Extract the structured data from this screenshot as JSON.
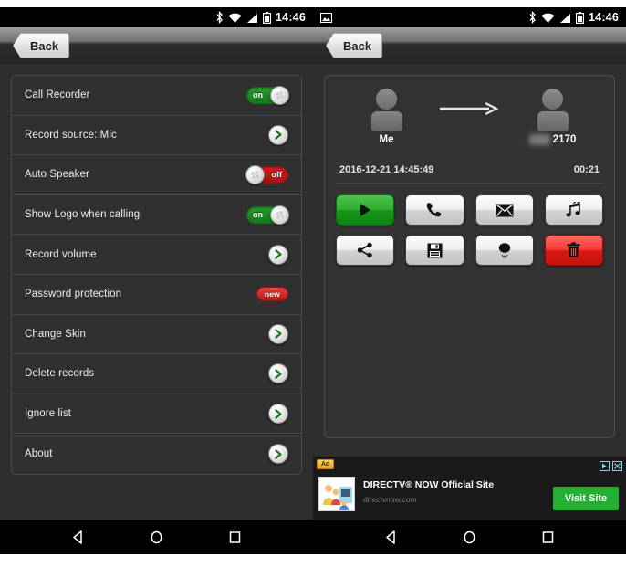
{
  "status_bar": {
    "time": "14:46",
    "icons_right": [
      "bluetooth-icon",
      "wifi-icon",
      "signal-icon",
      "battery-icon"
    ],
    "icon_left_right_panel": "screenshot-image-icon"
  },
  "left_panel": {
    "back_label": "Back",
    "settings": [
      {
        "label": "Call Recorder",
        "control": "toggle",
        "value": "on"
      },
      {
        "label": "Record source: Mic",
        "control": "arrow",
        "value": ""
      },
      {
        "label": "Auto Speaker",
        "control": "toggle",
        "value": "off"
      },
      {
        "label": "Show Logo when calling",
        "control": "toggle",
        "value": "on"
      },
      {
        "label": "Record volume",
        "control": "arrow",
        "value": ""
      },
      {
        "label": "Password protection",
        "control": "badge",
        "value": "new"
      },
      {
        "label": "Change Skin",
        "control": "arrow",
        "value": ""
      },
      {
        "label": "Delete records",
        "control": "arrow",
        "value": ""
      },
      {
        "label": "Ignore list",
        "control": "arrow",
        "value": ""
      },
      {
        "label": "About",
        "control": "arrow",
        "value": ""
      }
    ]
  },
  "right_panel": {
    "back_label": "Back",
    "caller": {
      "name": "Me"
    },
    "callee": {
      "blurred_prefix": "      ",
      "number": "2170"
    },
    "timestamp": "2016-12-21 14:45:49",
    "duration": "00:21",
    "actions": [
      {
        "name": "play-button",
        "icon": "play-icon",
        "style": "green"
      },
      {
        "name": "call-button",
        "icon": "phone-icon",
        "style": "light"
      },
      {
        "name": "email-button",
        "icon": "envelope-icon",
        "style": "light"
      },
      {
        "name": "ringtone-button",
        "icon": "music-note-icon",
        "style": "light"
      },
      {
        "name": "share-button",
        "icon": "share-icon",
        "style": "light"
      },
      {
        "name": "save-button",
        "icon": "floppy-disk-icon",
        "style": "light"
      },
      {
        "name": "speaker-button",
        "icon": "speaker-icon",
        "style": "light"
      },
      {
        "name": "delete-button",
        "icon": "trash-icon",
        "style": "red"
      }
    ]
  },
  "ad": {
    "badge": "Ad",
    "title": "DIRECTV® NOW Official Site",
    "url": "directvnow.com",
    "cta": "Visit Site"
  },
  "nav_bar": {
    "buttons": [
      "back-icon",
      "home-icon",
      "recents-icon"
    ]
  },
  "colors": {
    "toggle_on": "#23a12a",
    "toggle_off": "#d4201d",
    "accent_green": "#23b035",
    "delete_red": "#dc1712",
    "panel_bg": "#2e2e2e"
  }
}
